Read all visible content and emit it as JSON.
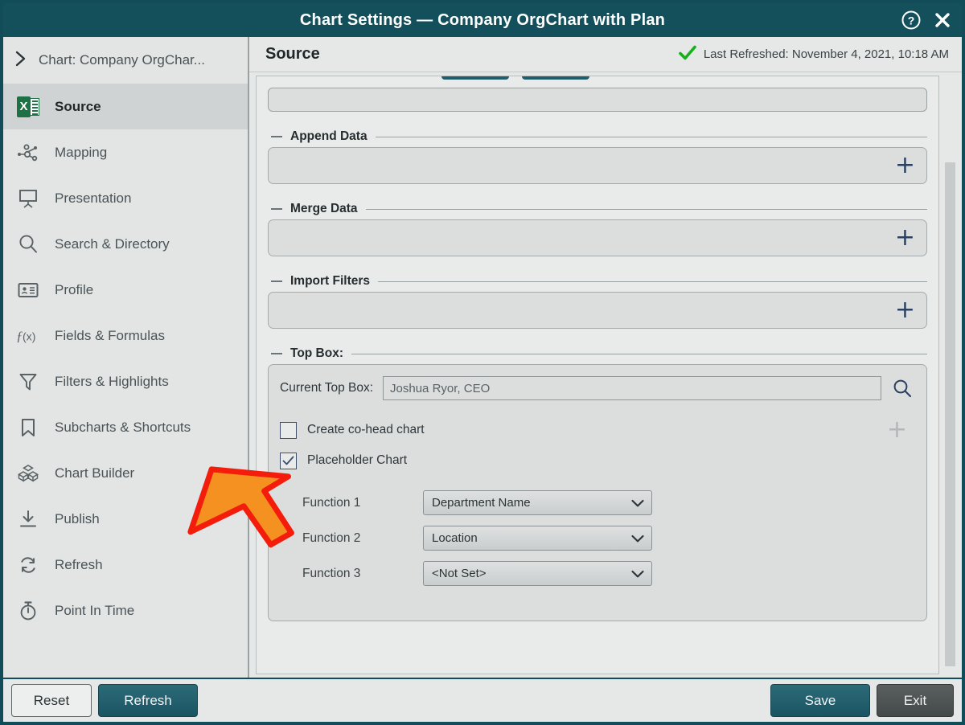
{
  "window": {
    "title": "Chart Settings — Company OrgChart with Plan",
    "help_icon": "help-circle-icon",
    "close_icon": "close-icon"
  },
  "sidebar": {
    "breadcrumb": {
      "chevron": "chevron-right-icon",
      "label": "Chart: Company OrgChar..."
    },
    "items": [
      {
        "label": "Source",
        "icon": "excel-spreadsheet-icon",
        "active": true
      },
      {
        "label": "Mapping",
        "icon": "mapping-nodes-icon",
        "active": false
      },
      {
        "label": "Presentation",
        "icon": "presentation-screen-icon",
        "active": false
      },
      {
        "label": "Search & Directory",
        "icon": "search-icon",
        "active": false
      },
      {
        "label": "Profile",
        "icon": "profile-card-icon",
        "active": false
      },
      {
        "label": "Fields & Formulas",
        "icon": "function-fx-icon",
        "active": false
      },
      {
        "label": "Filters & Highlights",
        "icon": "filter-funnel-icon",
        "active": false
      },
      {
        "label": "Subcharts & Shortcuts",
        "icon": "bookmark-icon",
        "active": false
      },
      {
        "label": "Chart Builder",
        "icon": "blocks-cube-icon",
        "active": false
      },
      {
        "label": "Publish",
        "icon": "publish-download-icon",
        "active": false
      },
      {
        "label": "Refresh",
        "icon": "refresh-cycle-icon",
        "active": false
      },
      {
        "label": "Point In Time",
        "icon": "stopwatch-icon",
        "active": false
      }
    ]
  },
  "main": {
    "header": {
      "title": "Source",
      "status_icon": "green-check-icon",
      "status_text": "Last Refreshed: November 4, 2021, 10:18 AM"
    },
    "sections": [
      {
        "title": "Append Data",
        "add_label": "+"
      },
      {
        "title": "Merge Data",
        "add_label": "+"
      },
      {
        "title": "Import Filters",
        "add_label": "+"
      }
    ],
    "top_box": {
      "title": "Top Box:",
      "current_label": "Current Top Box:",
      "current_value": "Joshua Ryor, CEO",
      "search_icon": "search-icon",
      "checkboxes": [
        {
          "label": "Create co-head chart",
          "checked": false,
          "add_label": "+",
          "add_disabled": true
        },
        {
          "label": "Placeholder Chart",
          "checked": true
        }
      ],
      "functions": [
        {
          "label": "Function 1",
          "value": "Department Name"
        },
        {
          "label": "Function 2",
          "value": "Location"
        },
        {
          "label": "Function 3",
          "value": "<Not Set>"
        }
      ]
    }
  },
  "footer": {
    "reset_label": "Reset",
    "refresh_label": "Refresh",
    "save_label": "Save",
    "exit_label": "Exit"
  },
  "annotation": {
    "type": "orange-arrow",
    "fill": "#F59120",
    "stroke": "#F41C0B",
    "points_to": "Placeholder Chart checkbox"
  },
  "colors": {
    "titlebar": "#14505c",
    "accent_teal": "#1a5462",
    "window_bg": "#e6e8e8",
    "status_green": "#15b01a"
  }
}
